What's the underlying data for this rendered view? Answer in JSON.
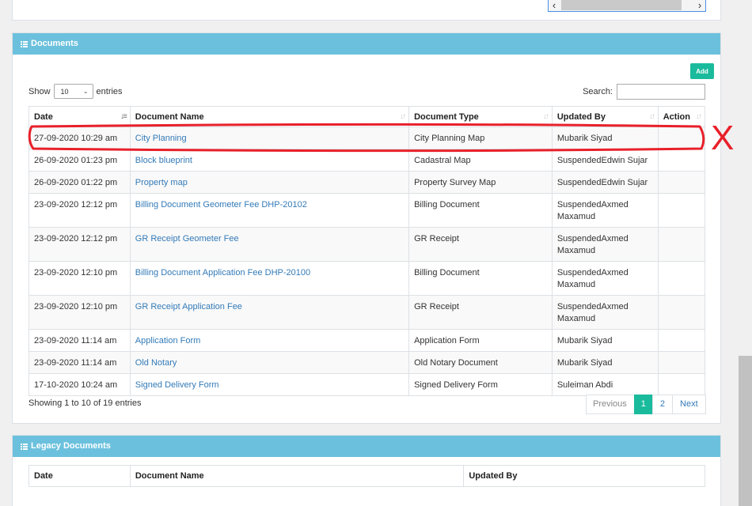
{
  "documents": {
    "title": "Documents",
    "add_label": "Add",
    "show_label": "Show",
    "entries_label": "entries",
    "page_size": "10",
    "search_label": "Search:",
    "search_value": "",
    "columns": {
      "date": "Date",
      "name": "Document Name",
      "type": "Document Type",
      "updated_by": "Updated By",
      "action": "Action"
    },
    "rows": [
      {
        "date": "27-09-2020 10:29 am",
        "name": "City Planning",
        "type": "City Planning Map",
        "updated_by": "Mubarik Siyad",
        "action": ""
      },
      {
        "date": "26-09-2020 01:23 pm",
        "name": "Block blueprint",
        "type": "Cadastral Map",
        "updated_by": "SuspendedEdwin Sujar",
        "action": ""
      },
      {
        "date": "26-09-2020 01:22 pm",
        "name": "Property map",
        "type": "Property Survey Map",
        "updated_by": "SuspendedEdwin Sujar",
        "action": ""
      },
      {
        "date": "23-09-2020 12:12 pm",
        "name": "Billing Document Geometer Fee DHP-20102",
        "type": "Billing Document",
        "updated_by": "SuspendedAxmed Maxamud",
        "action": ""
      },
      {
        "date": "23-09-2020 12:12 pm",
        "name": "GR Receipt Geometer Fee",
        "type": "GR Receipt",
        "updated_by": "SuspendedAxmed Maxamud",
        "action": ""
      },
      {
        "date": "23-09-2020 12:10 pm",
        "name": "Billing Document Application Fee DHP-20100",
        "type": "Billing Document",
        "updated_by": "SuspendedAxmed Maxamud",
        "action": ""
      },
      {
        "date": "23-09-2020 12:10 pm",
        "name": "GR Receipt Application Fee",
        "type": "GR Receipt",
        "updated_by": "SuspendedAxmed Maxamud",
        "action": ""
      },
      {
        "date": "23-09-2020 11:14 am",
        "name": "Application Form",
        "type": "Application Form",
        "updated_by": "Mubarik Siyad",
        "action": ""
      },
      {
        "date": "23-09-2020 11:14 am",
        "name": "Old Notary",
        "type": "Old Notary Document",
        "updated_by": "Mubarik Siyad",
        "action": ""
      },
      {
        "date": "17-10-2020 10:24 am",
        "name": "Signed Delivery Form",
        "type": "Signed Delivery Form",
        "updated_by": "Suleiman Abdi",
        "action": ""
      }
    ],
    "info": "Showing 1 to 10 of 19 entries",
    "pagination": {
      "previous": "Previous",
      "pages": [
        "1",
        "2"
      ],
      "current": "1",
      "next": "Next"
    }
  },
  "legacy": {
    "title": "Legacy Documents",
    "columns": {
      "date": "Date",
      "name": "Document Name",
      "updated_by": "Updated By"
    }
  },
  "annotation": {
    "mark": "X",
    "color": "#e8202a"
  },
  "colors": {
    "panel_header": "#6bc1dd",
    "accent": "#1abb9c",
    "link": "#337ab7"
  }
}
